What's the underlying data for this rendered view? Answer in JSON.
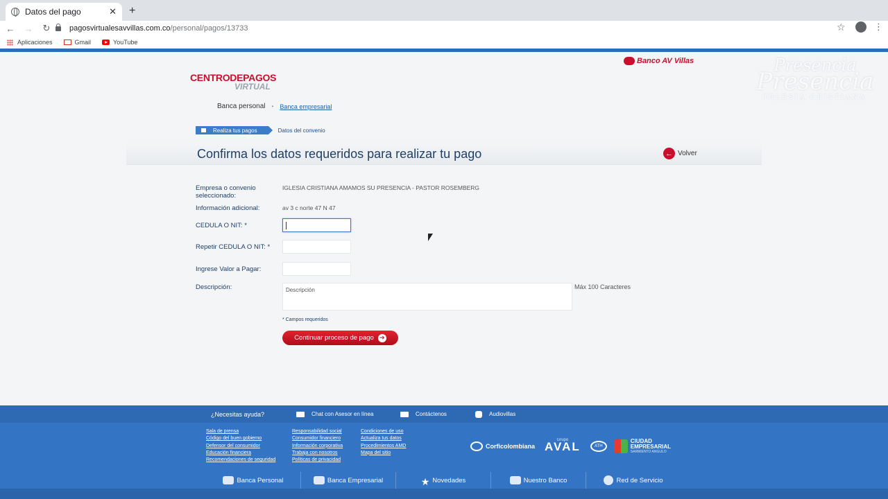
{
  "browser": {
    "tab_title": "Datos del pago",
    "url_domain": "pagosvirtualesavvillas.com.co",
    "url_path": "/personal/pagos/13733",
    "bookmarks": [
      "Aplicaciones",
      "Gmail",
      "YouTube"
    ]
  },
  "header": {
    "logo_top": "CENTRODEPAGOS",
    "logo_bottom": "VIRTUAL",
    "bank_name": "Banco AV Villas",
    "watermark": [
      "Presencia",
      "Presencia",
      "IGLESIA CRISTIANA"
    ],
    "banca_personal": "Banca personal",
    "banca_empresarial": "Banca empresarial"
  },
  "breadcrumb": {
    "home": "Realiza tus pagos",
    "current": "Datos del convenio"
  },
  "main": {
    "title": "Confirma los datos requeridos para realizar tu pago",
    "back_label": "Volver",
    "company_label": "Empresa o convenio seleccionado:",
    "company_value": "IGLESIA CRISTIANA AMAMOS SU PRESENCIA - PASTOR ROSEMBERG",
    "info_label": "Información adicional:",
    "info_value": "av 3 c norte 47 N 47",
    "cedula_label": "CEDULA O NIT: *",
    "cedula_value": "",
    "cedula_repeat_label": "Repetir CEDULA O NIT: *",
    "cedula_repeat_value": "",
    "amount_label": "Ingrese Valor a Pagar:",
    "amount_value": "",
    "description_label": "Descripción:",
    "description_placeholder": "Descripción",
    "max_chars": "Máx 100 Caracteres",
    "required_note": "* Campos requeridos",
    "continue_label": "Continuar proceso de pago"
  },
  "footer": {
    "help": "¿Necesitas ayuda?",
    "chat": "Chat con Asesor en línea",
    "contact": "Contáctenos",
    "audio": "Audiovillas",
    "links_col1": [
      "Sala de prensa",
      "Código del buen gobierno",
      "Defensor del consumidor",
      "Educación financiera",
      "Recomendaciones de seguridad"
    ],
    "links_col2": [
      "Responsabilidad social",
      "Consumidor financiero",
      "Información corporativa",
      "Trabaja con nosotros",
      "Políticas de privacidad"
    ],
    "links_col3": [
      "Condiciones de uso",
      "Actualiza tus datos",
      "Procedimientos AMD",
      "Mapa del sitio"
    ],
    "logo_corfi": "Corficolombiana",
    "logo_grupo": "Grupo",
    "logo_aval": "AVAL",
    "logo_ath": "ATH",
    "logo_ciudad": "CIUDAD",
    "logo_empresarial": "EMPRESARIAL",
    "logo_ciudad_sub": "SARMIENTO ANGULO",
    "nav": [
      "Banca Personal",
      "Banca Empresarial",
      "Novedades",
      "Nuestro Banco",
      "Red de Servicio"
    ]
  }
}
